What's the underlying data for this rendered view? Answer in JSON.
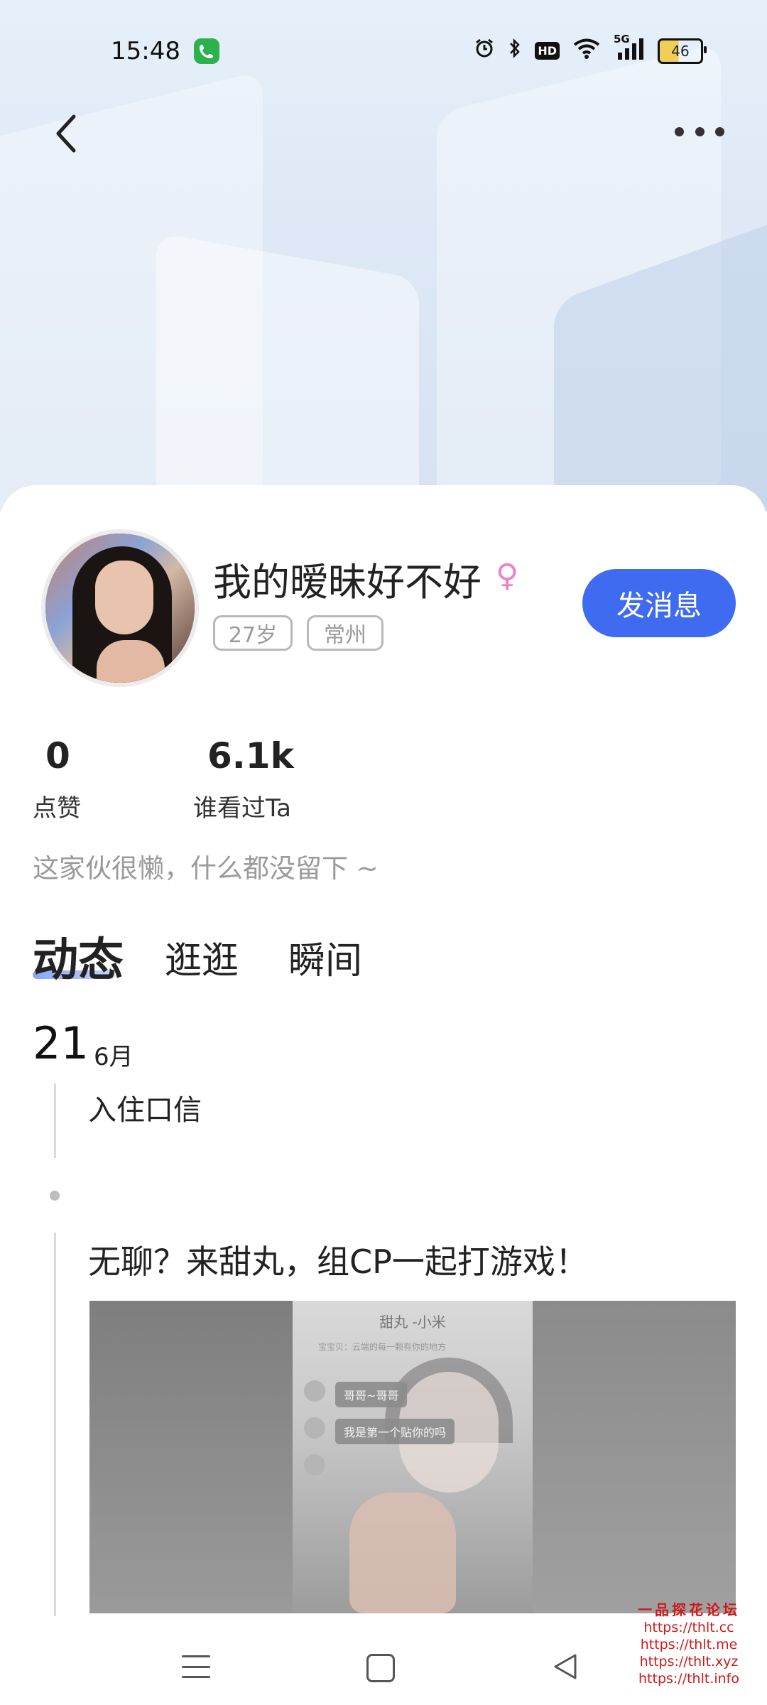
{
  "status_bar": {
    "time": "15:48",
    "signal_label": "5G",
    "hd_label": "HD",
    "battery": "46",
    "icons": [
      "phone-call-icon",
      "alarm-icon",
      "bluetooth-icon",
      "hd-icon",
      "wifi-icon",
      "cellular-signal-icon",
      "battery-icon"
    ]
  },
  "header": {
    "back_icon": "chevron-left-icon",
    "more_icon": "more-horizontal-icon"
  },
  "profile": {
    "name": "我的暧昧好不好",
    "gender_symbol": "♀",
    "gender_color": "#ef7fc6",
    "tags": [
      "27岁",
      "常州"
    ],
    "send_message_label": "发消息",
    "accent_color": "#3e6bf0",
    "stats": [
      {
        "value": "0",
        "label": "点赞"
      },
      {
        "value": "6.1k",
        "label": "谁看过Ta"
      }
    ],
    "bio": "这家伙很懒，什么都没留下 ~"
  },
  "tabs": [
    {
      "label": "动态",
      "active": true
    },
    {
      "label": "逛逛",
      "active": false
    },
    {
      "label": "瞬间",
      "active": false
    }
  ],
  "timeline": {
    "day": "21",
    "month": "6月",
    "join_text": "入住口信",
    "post": {
      "text": "无聊？来甜丸，组CP一起打游戏！",
      "image": {
        "title": "甜丸 -小米",
        "subtitle": "宝宝贝：云端的每一颗有你的地方",
        "bubbles": [
          "哥哥~哥哥",
          "我是第一个贴你的吗"
        ]
      }
    }
  },
  "watermark": {
    "title": "一品探花论坛",
    "links": [
      "https://thlt.cc",
      "https://thlt.me",
      "https://thlt.xyz",
      "https://thlt.info"
    ]
  },
  "nav": {
    "icons": [
      "menu-icon",
      "home-icon",
      "back-triangle-icon"
    ]
  }
}
